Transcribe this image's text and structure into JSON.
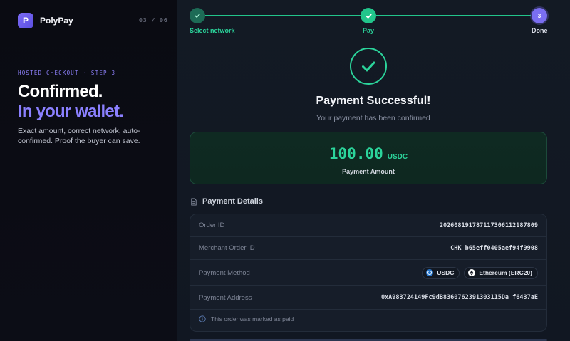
{
  "brand": {
    "logo_letter": "P",
    "name": "PolyPay",
    "step_counter": "03 / 06"
  },
  "hero": {
    "eyebrow": "HOSTED CHECKOUT · STEP 3",
    "headline_line1": "Confirmed.",
    "headline_line2": "In your wallet.",
    "blurb": "Exact amount, correct network, auto-confirmed. Proof the buyer can save."
  },
  "stepper": {
    "steps": [
      {
        "label": "Select network",
        "status": "done"
      },
      {
        "label": "Pay",
        "status": "done"
      },
      {
        "label": "Done",
        "number": "3",
        "status": "current"
      }
    ]
  },
  "result": {
    "title": "Payment Successful!",
    "subtitle": "Your payment has been confirmed"
  },
  "amount": {
    "value": "100.00",
    "currency": "USDC",
    "label": "Payment Amount"
  },
  "details": {
    "heading": "Payment Details",
    "rows": {
      "order_id": {
        "label": "Order ID",
        "value": "20260819178711730611218780​9"
      },
      "merchant_order_id": {
        "label": "Merchant Order ID",
        "value": "CHK_b65eff0405aef94f9908"
      },
      "payment_method": {
        "label": "Payment Method",
        "token": "USDC",
        "network": "Ethereum (ERC20)"
      },
      "payment_address": {
        "label": "Payment Address",
        "value": "0xA983724149Fc9dB8360762391303115Da f6437aE"
      }
    },
    "note": "This order was marked as paid"
  },
  "colors": {
    "accent": "#8b80ff",
    "success": "#2bd49b",
    "brand": "#6c5ef0"
  }
}
